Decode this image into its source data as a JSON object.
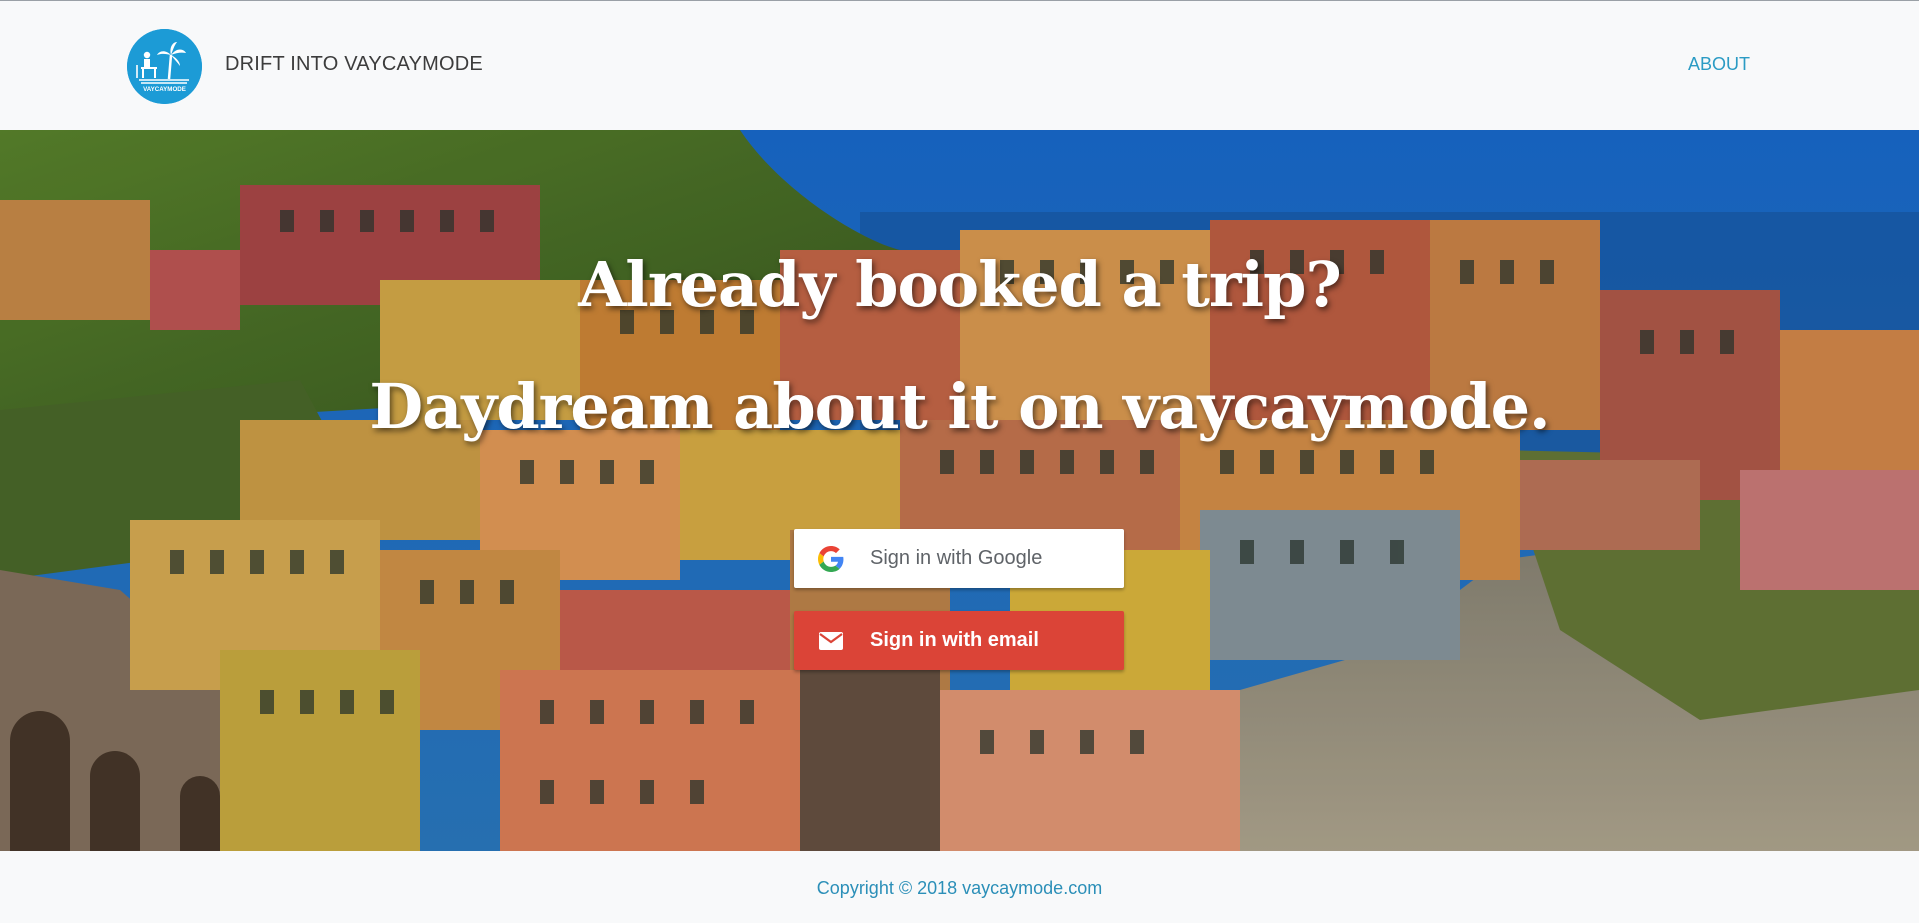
{
  "header": {
    "brand": "DRIFT INTO VAYCAYMODE",
    "logo_text": "VAYCAYMODE",
    "nav": {
      "about": "ABOUT"
    }
  },
  "hero": {
    "headline_1": "Already booked a trip?",
    "headline_2": "Daydream about it on vaycaymode.",
    "google_button": "Sign in with Google",
    "email_button": "Sign in with email"
  },
  "footer": {
    "copyright": "Copyright © 2018 vaycaymode.com"
  },
  "icons": {
    "logo": "beach-chair-palm-icon",
    "google": "google-g-icon",
    "email": "envelope-icon"
  },
  "colors": {
    "accent": "#1c9bd6",
    "link": "#2b9bc4",
    "email_button": "#db4437",
    "google_button": "#ffffff"
  }
}
